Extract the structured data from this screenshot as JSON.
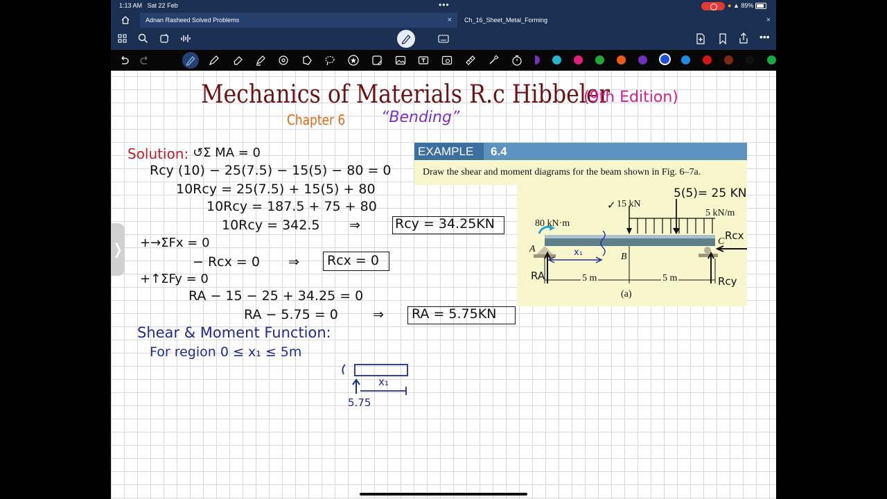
{
  "status_bar": {
    "time": "1:13 AM",
    "date": "Sat 22 Feb",
    "battery": "89%"
  },
  "tabs": [
    {
      "label": "Adnan Rasheed Solved Problems",
      "active": true
    },
    {
      "label": "Ch_16_Sheet_Metal_Forming",
      "active": false
    }
  ],
  "toolbar_icons": [
    "home-icon",
    "grid-icon",
    "search-icon",
    "bookmark-icon",
    "audio-icon",
    "pen-mode-icon",
    "keyboard-icon",
    "new-page-icon",
    "bookmark-outline-icon",
    "share-icon",
    "more-icon"
  ],
  "tool_icons": [
    "undo-icon",
    "redo-icon",
    "pen-icon",
    "pencil-icon",
    "eraser-icon",
    "highlighter-icon",
    "shape-icon",
    "lasso-icon",
    "star-icon",
    "sticker-icon",
    "image-icon",
    "textbox-icon",
    "camera-icon",
    "ruler-icon",
    "laser-icon",
    "timer-icon"
  ],
  "palette": [
    "#7b2fbe",
    "#26b5cc",
    "#e0207a",
    "#20a838",
    "#f05a1a",
    "#6f2fb8",
    "#1e4fd6",
    "#1e8de0",
    "#d41818",
    "#7a2a10",
    "#111111",
    "#18a848"
  ],
  "note": {
    "title": "Mechanics of Materials R.c Hibbeler",
    "edition": "(9th Edition)",
    "chapter": "Chapter 6",
    "topic": "“Bending”",
    "solution_label": "Solution:",
    "lines": {
      "moment_eq": "↺Σ MA = 0",
      "l1": "Rcy (10) − 25(7.5) − 15(5) − 80 = 0",
      "l2": "10Rcy = 25(7.5) + 15(5) + 80",
      "l3": "10Rcy = 187.5 + 75 + 80",
      "l4": "10Rcy = 342.5",
      "l4_arrow": "⇒",
      "ans_rcy": "Rcy = 34.25KN",
      "sum_fx": "+→ΣFx = 0",
      "l5": "− Rcx = 0",
      "l5_arrow": "⇒",
      "ans_rcx": "Rcx = 0",
      "sum_fy": "+↑ΣFy = 0",
      "l6": "RA − 15 − 25 + 34.25 = 0",
      "l7": "RA − 5.75 = 0",
      "l7_arrow": "⇒",
      "ans_ra": "RA = 5.75KN"
    },
    "shear_heading": "Shear & Moment Function:",
    "region": "For region  0 ≤ x₁ ≤ 5m",
    "sketch_x_label": "x₁",
    "sketch_value": "5.75"
  },
  "example": {
    "label": "EXAMPLE",
    "number": "6.4",
    "text": "Draw the shear and moment diagrams for the beam shown in Fig. 6–7a.",
    "fig": {
      "point_load": "15 kN",
      "point_load_check": "✓",
      "dist_load": "5 kN/m",
      "dist_resultant": "5(5)= 25 KN",
      "moment": "80 kN·m",
      "A": "A",
      "B": "B",
      "C": "C",
      "x_label": "x₁",
      "span1": "5 m",
      "span2": "5 m",
      "caption": "(a)",
      "RA": "RA",
      "Rcy": "Rcy",
      "Rcx": "Rcx"
    }
  }
}
